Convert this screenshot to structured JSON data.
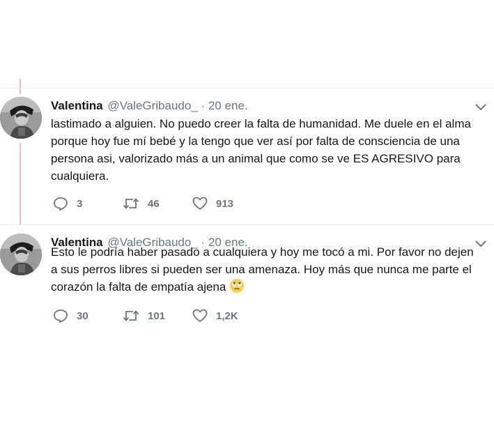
{
  "tweets": [
    {
      "name": "Valentina",
      "handle": "@ValeGribaudo_",
      "separator": "·",
      "date": "20 ene.",
      "text": "lastimado a alguien. No puedo creer la falta de humanidad. Me duele en el alma porque hoy fue mí bebé y la tengo que ver así por falta de consciencia de una persona asi, valorizado más a un animal que como se ve ES AGRESIVO para cualquiera.",
      "emoji": "",
      "replies": "3",
      "retweets": "46",
      "likes": "913"
    },
    {
      "name": "Valentina",
      "handle": "@ValeGribaudo_",
      "separator": "·",
      "date": "20 ene.",
      "text": "Esto le podría haber pasado a cualquiera y hoy me tocó a mi. Por favor no dejen a sus perros libres si pueden ser una amenaza. Hoy más que nunca me parte el corazón la falta de empatía ajena",
      "emoji": "rolling-eyes-face",
      "replies": "30",
      "retweets": "101",
      "likes": "1,2K"
    }
  ],
  "icons": {
    "reply": "reply-icon",
    "retweet": "retweet-icon",
    "like": "heart-icon",
    "menu": "chevron-down-icon"
  },
  "colors": {
    "thread_line": "#f7b6c8",
    "secondary_text": "#657786",
    "primary_text": "#14171a"
  }
}
